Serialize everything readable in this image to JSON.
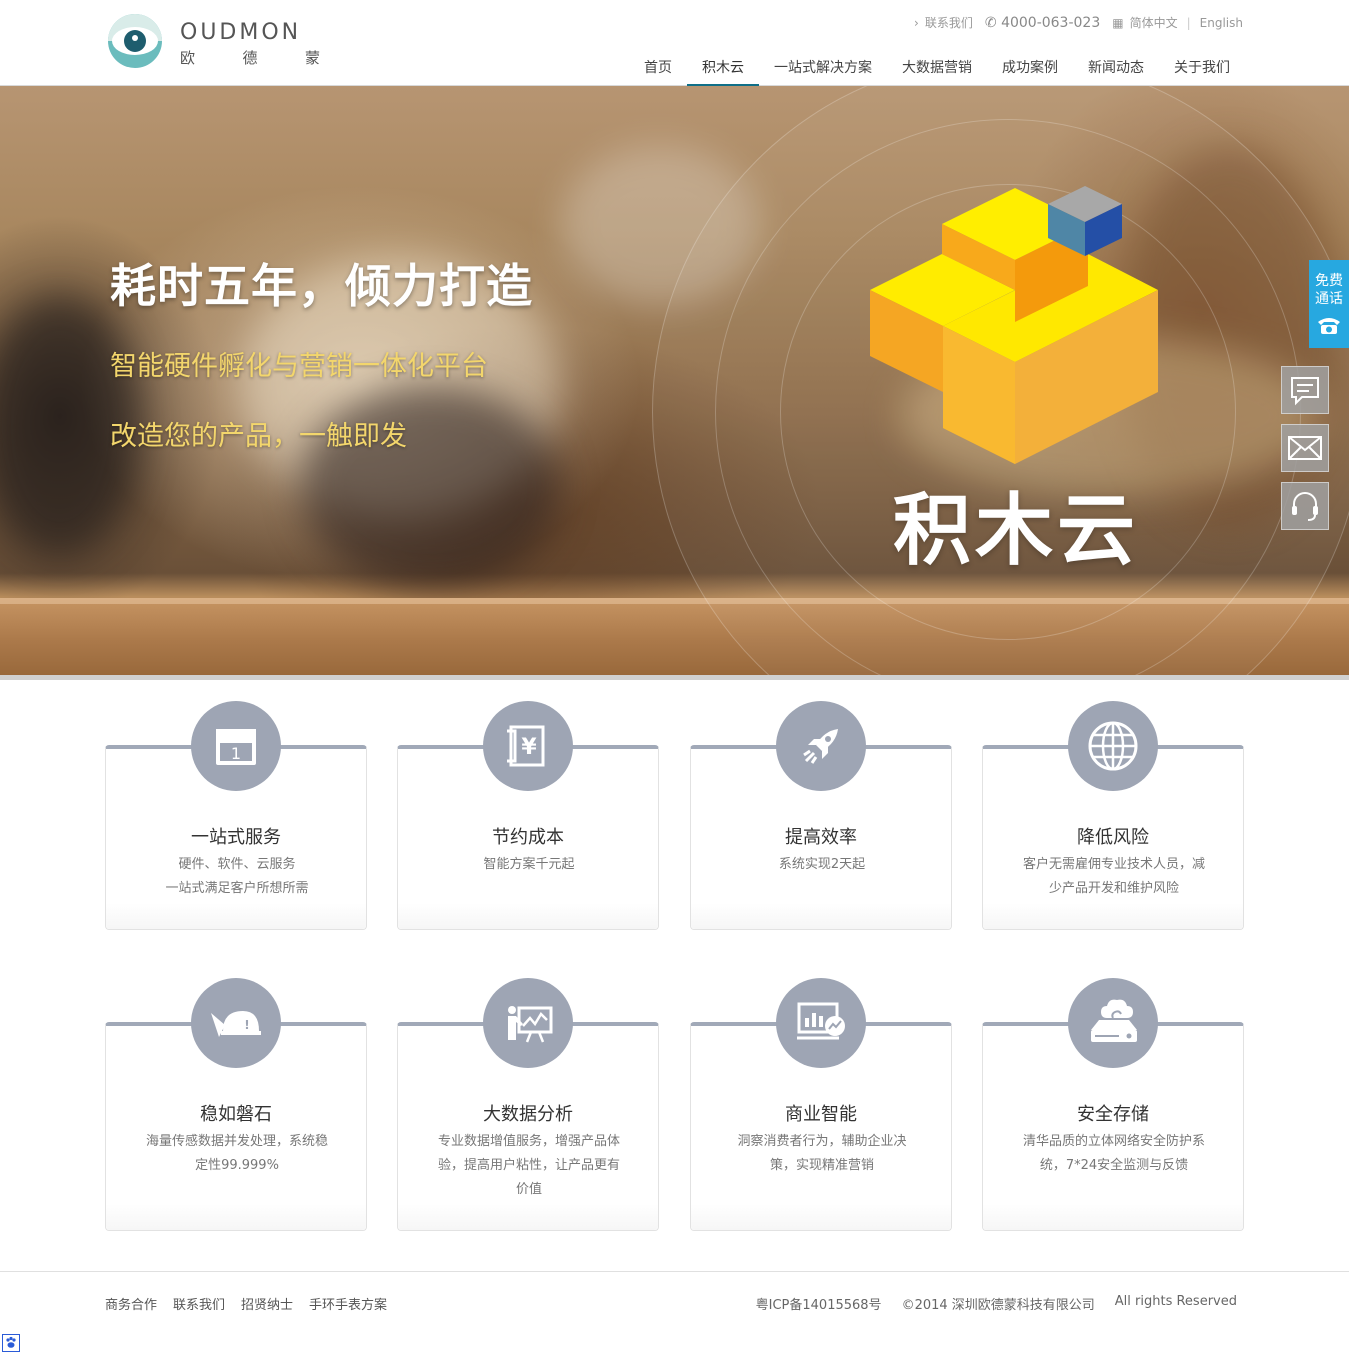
{
  "header": {
    "logo_en": "OUDMON",
    "logo_cn": [
      "欧",
      "德",
      "蒙"
    ],
    "top_links": {
      "contact": "联系我们",
      "phone": "4000-063-023",
      "lang_cn": "简体中文",
      "lang_en": "English"
    },
    "nav": [
      {
        "label": "首页",
        "active": false
      },
      {
        "label": "积木云",
        "active": true
      },
      {
        "label": "一站式解决方案",
        "active": false
      },
      {
        "label": "大数据营销",
        "active": false
      },
      {
        "label": "成功案例",
        "active": false
      },
      {
        "label": "新闻动态",
        "active": false
      },
      {
        "label": "关于我们",
        "active": false
      }
    ]
  },
  "banner": {
    "title": "耗时五年，倾力打造",
    "subtitle1": "智能硬件孵化与营销一体化平台",
    "subtitle2": "改造您的产品，一触即发",
    "brand": "积木云"
  },
  "float": {
    "call_line1": "免费",
    "call_line2": "通话",
    "accent": "#27a8e0"
  },
  "features": [
    {
      "title": "一站式服务",
      "desc": [
        "硬件、软件、云服务",
        "一站式满足客户所想所需"
      ],
      "icon": "calendar-store-icon"
    },
    {
      "title": "节约成本",
      "desc": [
        "智能方案千元起"
      ],
      "icon": "yuan-receipt-icon"
    },
    {
      "title": "提高效率",
      "desc": [
        "系统实现2天起"
      ],
      "icon": "rocket-icon"
    },
    {
      "title": "降低风险",
      "desc": [
        "客户无需雇佣专业技术人员，减",
        "少产品开发和维护风险"
      ],
      "icon": "globe-icon"
    },
    {
      "title": "稳如磐石",
      "desc": [
        "海量传感数据并发处理，系统稳",
        "定性99.999%"
      ],
      "icon": "helmet-icon"
    },
    {
      "title": "大数据分析",
      "desc": [
        "专业数据增值服务，增强产品体",
        "验，提高用户粘性，让产品更有",
        "价值"
      ],
      "icon": "presentation-chart-icon"
    },
    {
      "title": "商业智能",
      "desc": [
        "洞察消费者行为，辅助企业决",
        "策，实现精准营销"
      ],
      "icon": "monitor-analytics-icon"
    },
    {
      "title": "安全存储",
      "desc": [
        "清华品质的立体网络安全防护系",
        "统，7*24安全监测与反馈"
      ],
      "icon": "cloud-storage-icon"
    }
  ],
  "footer": {
    "links": [
      "商务合作",
      "联系我们",
      "招贤纳士",
      "手环手表方案"
    ],
    "icp": "粤ICP备14015568号",
    "copyright": "©2014 深圳欧德蒙科技有限公司",
    "rights": "All rights Reserved"
  },
  "colors": {
    "nav_active": "#0f6f88",
    "card_accent": "#a1a9b8",
    "hero_subtitle": "#f3d66c"
  }
}
